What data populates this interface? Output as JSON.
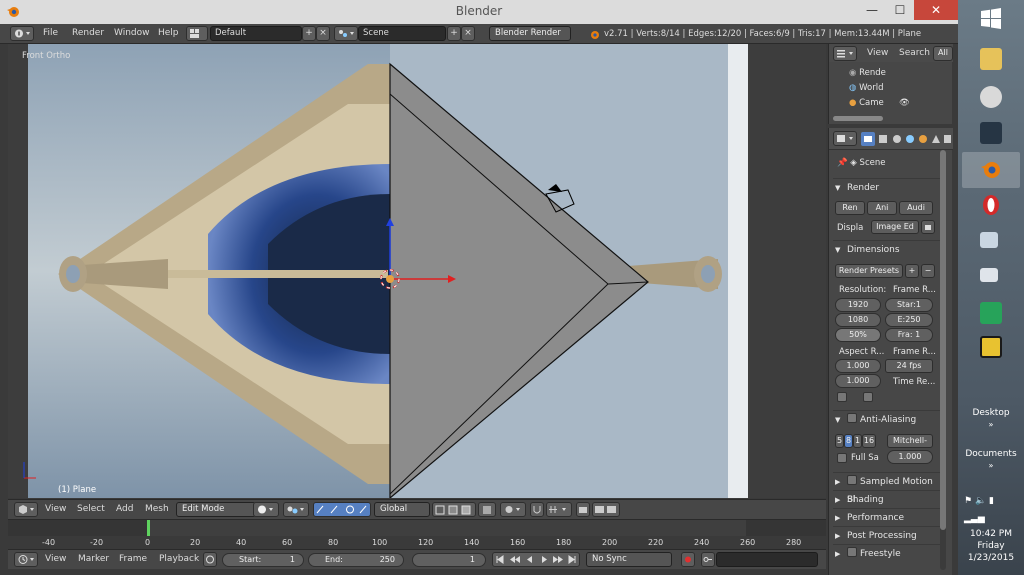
{
  "window": {
    "title": "Blender",
    "minimize": "—",
    "maximize": "☐",
    "close": "✕"
  },
  "topbar": {
    "menus": [
      "File",
      "Render",
      "Window",
      "Help"
    ],
    "layout": "Default",
    "scene": "Scene",
    "engine": "Blender Render",
    "stats": "v2.71 | Verts:8/14 | Edges:12/20 | Faces:6/9 | Tris:17 | Mem:13.44M | Plane"
  },
  "viewport": {
    "view_label": "Front Ortho",
    "object_label": "(1) Plane",
    "header": {
      "menus": [
        "View",
        "Select",
        "Add",
        "Mesh"
      ],
      "mode": "Edit Mode",
      "orientation": "Global"
    }
  },
  "timeline": {
    "ticks": [
      "-40",
      "-20",
      "0",
      "20",
      "40",
      "60",
      "80",
      "100",
      "120",
      "140",
      "160",
      "180",
      "200",
      "220",
      "240",
      "260",
      "280"
    ],
    "header": {
      "menus": [
        "View",
        "Marker",
        "Frame",
        "Playback"
      ],
      "start_label": "Start:",
      "start_value": "1",
      "end_label": "End:",
      "end_value": "250",
      "current": "1",
      "sync": "No Sync"
    }
  },
  "outliner": {
    "view": "View",
    "search": "Search",
    "all": "All",
    "rows": [
      "Rende",
      "World",
      "Came"
    ]
  },
  "properties": {
    "context": "Scene",
    "render_section": "Render",
    "render_buttons": [
      "Ren",
      "Ani",
      "Audi"
    ],
    "display_label": "Displa",
    "display_value": "Image Ed",
    "dimensions_section": "Dimensions",
    "render_presets": "Render Presets",
    "resolution_label": "Resolution:",
    "res_x": "1920",
    "res_y": "1080",
    "res_pct": "50%",
    "frame_range_label": "Frame R...",
    "frame_start": "Star:1",
    "frame_end": "E:250",
    "frame_step": "Fra: 1",
    "aspect_label": "Aspect R...",
    "aspect_x": "1.000",
    "aspect_y": "1.000",
    "frame_rate_label": "Frame R...",
    "fps": "24 fps",
    "time_remap_label": "Time Re...",
    "aa_section": "Anti-Aliasing",
    "aa_samples": [
      "5",
      "8",
      "1",
      "16"
    ],
    "aa_filter": "Mitchell-",
    "full_sample": "Full Sa",
    "filter_size": "1.000",
    "sampled_motion": "Sampled Motion Bl",
    "shading": "Shading",
    "performance": "Performance",
    "post_processing": "Post Processing",
    "freestyle": "Freestyle"
  },
  "taskbar": {
    "desktop": "Desktop",
    "documents": "Documents",
    "time": "10:42 PM",
    "day": "Friday",
    "date": "1/23/2015"
  },
  "colors": {
    "blender_orange": "#e87d0d",
    "selection_blue": "#5680c2",
    "playhead_green": "#5fd35f"
  }
}
